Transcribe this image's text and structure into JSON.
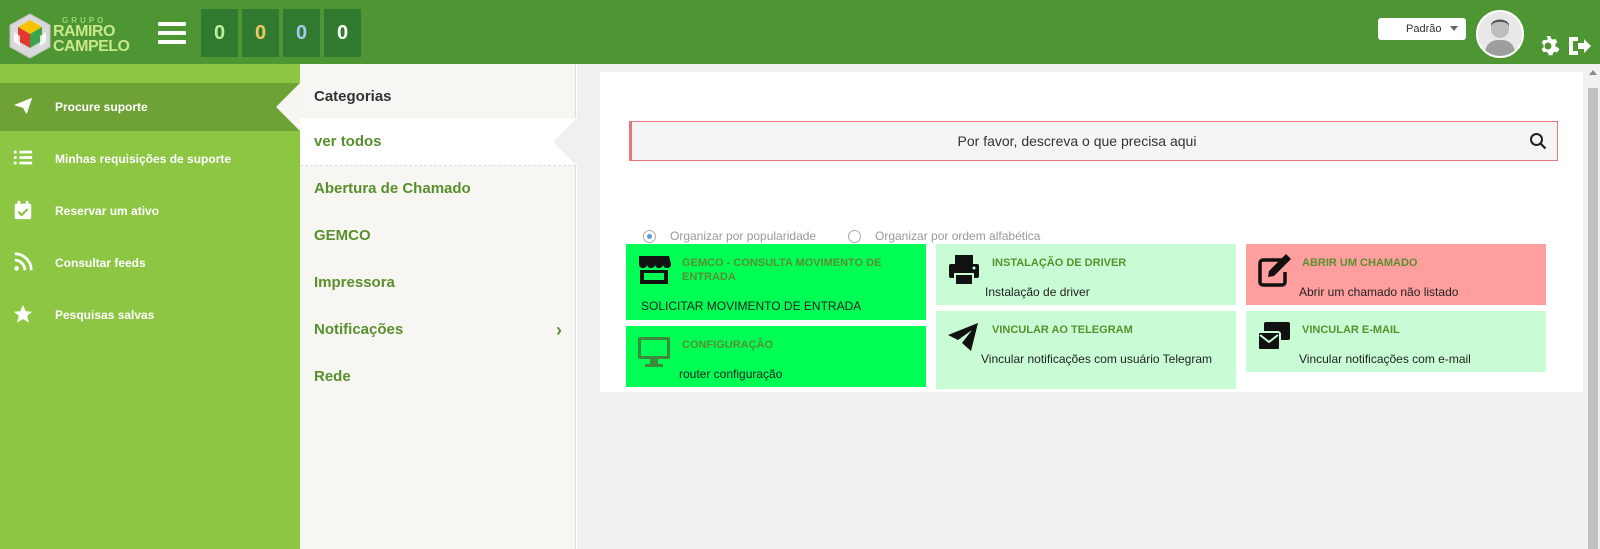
{
  "header": {
    "logo_group": "GRUPO",
    "logo_line1": "RAMIRO",
    "logo_line2": "CAMPELO",
    "counters": [
      {
        "value": "0",
        "color": "#b9f29a"
      },
      {
        "value": "0",
        "color": "#f0c86a"
      },
      {
        "value": "0",
        "color": "#a8c8f0"
      },
      {
        "value": "0",
        "color": "#ffffff"
      }
    ],
    "profile_select": "Padrão",
    "icons": [
      "menu-icon",
      "avatar",
      "gear-icon",
      "logout-icon"
    ]
  },
  "sidebar": {
    "items": [
      {
        "label": "Procure suporte",
        "icon": "paper-plane-icon",
        "active": true
      },
      {
        "label": "Minhas requisições de suporte",
        "icon": "list-icon"
      },
      {
        "label": "Reservar um ativo",
        "icon": "calendar-check-icon"
      },
      {
        "label": "Consultar feeds",
        "icon": "rss-icon"
      },
      {
        "label": "Pesquisas salvas",
        "icon": "star-icon"
      }
    ]
  },
  "categories": {
    "heading": "Categorias",
    "items": [
      {
        "label": "ver todos",
        "selected": true
      },
      {
        "label": "Abertura de Chamado"
      },
      {
        "label": "GEMCO"
      },
      {
        "label": "Impressora"
      },
      {
        "label": "Notificações",
        "has_children": true
      },
      {
        "label": "Rede"
      }
    ]
  },
  "main": {
    "search_placeholder": "Por favor, descreva o que precisa aqui",
    "sort_options": [
      {
        "label": "Organizar por popularidade",
        "checked": true
      },
      {
        "label": "Organizar por ordem alfabética",
        "checked": false
      }
    ],
    "cards": [
      {
        "title": "GEMCO - CONSULTA MOVIMENTO DE ENTRADA",
        "desc": "SOLICITAR MOVIMENTO DE ENTRADA",
        "icon": "store-icon",
        "bg": "#00ff55"
      },
      {
        "title": "INSTALAÇÃO DE DRIVER",
        "desc": "Instalação de driver",
        "icon": "printer-icon",
        "bg": "#c8fcd4"
      },
      {
        "title": "ABRIR UM CHAMADO",
        "desc": "Abrir um chamado não listado",
        "icon": "edit-icon",
        "bg": "#ff9e9e"
      },
      {
        "title": "CONFIGURAÇÃO",
        "desc": "router configuração",
        "icon": "monitor-icon",
        "bg": "#00ff55"
      },
      {
        "title": "VINCULAR AO TELEGRAM",
        "desc": "Vincular notificações com usuário Telegram",
        "icon": "telegram-icon",
        "bg": "#c8fcd4"
      },
      {
        "title": "VINCULAR E-MAIL",
        "desc": "Vincular notificações com e-mail",
        "icon": "envelope-icon",
        "bg": "#c8fcd4"
      }
    ]
  },
  "colors": {
    "topbar": "#4d9633",
    "sidebar": "#8cc643",
    "sidebar_active": "#6fa235",
    "category_text": "#5a8f2e",
    "search_border": "#e5767a"
  }
}
